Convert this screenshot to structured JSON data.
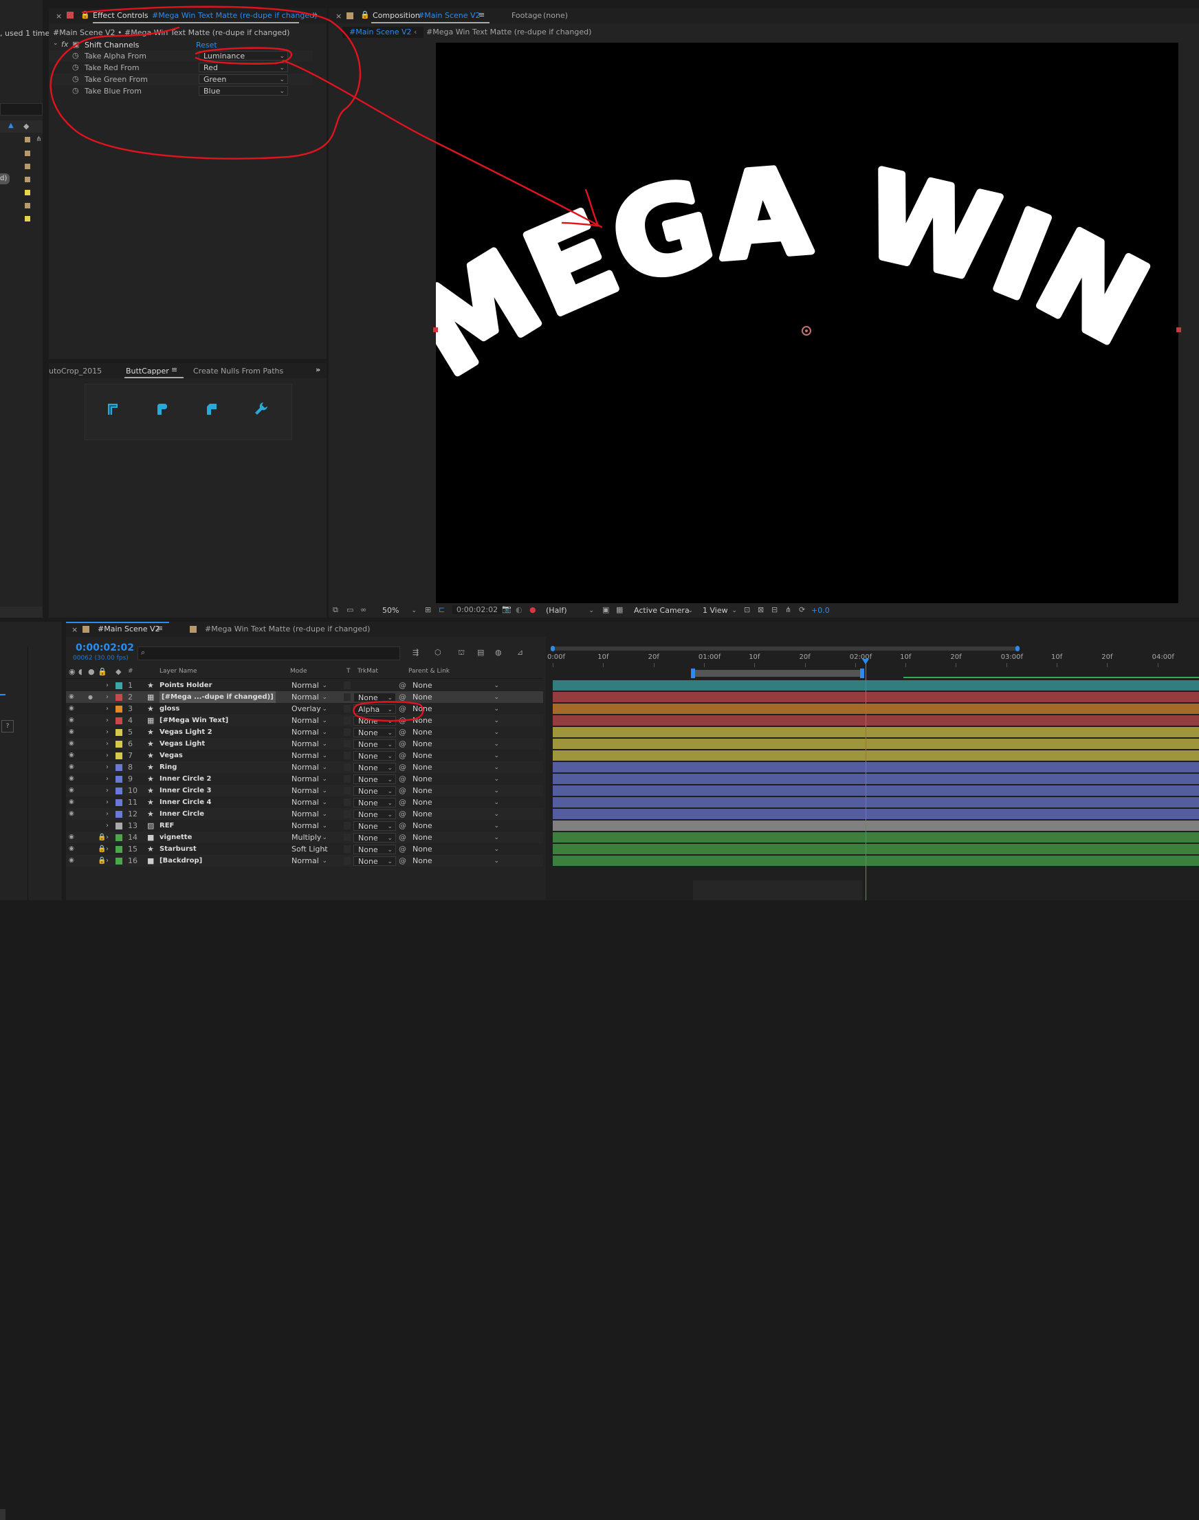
{
  "colors": {
    "accent": "#2d8ceb",
    "annotation": "#e0141e",
    "panel": "#232323",
    "teal": "#3aa6a6",
    "red": "#c8484b",
    "orange": "#e08a2c",
    "yellow": "#d6c84a",
    "blue": "#6a78d6",
    "gray": "#a9a9a9",
    "green": "#4aa84a",
    "cyan_icon": "#2aa8d8"
  },
  "left_strip": {
    "used_text": ", used 1 time",
    "label_d": "d)"
  },
  "effect_controls": {
    "tab_title": "Effect Controls",
    "tab_target": "#Mega Win Text Matte (re-dupe if changed)",
    "breadcrumb": "#Main Scene V2 • #Mega Win Text Matte (re-dupe if changed)",
    "effect_name": "Shift Channels",
    "reset": "Reset",
    "props": [
      {
        "label": "Take Alpha From",
        "value": "Luminance"
      },
      {
        "label": "Take Red From",
        "value": "Red"
      },
      {
        "label": "Take Green From",
        "value": "Green"
      },
      {
        "label": "Take Blue From",
        "value": "Blue"
      }
    ]
  },
  "scripts_panel": {
    "tabs": [
      "utoCrop_2015",
      "ButtCapper",
      "Create Nulls From Paths"
    ],
    "icons": [
      "butt-cap-icon",
      "round-cap-icon",
      "square-cap-icon",
      "wrench-icon"
    ]
  },
  "composition": {
    "tab_label": "Composition",
    "tab_name": "#Main Scene V2",
    "footage": "Footage",
    "footage_val": "(none)",
    "crumb_active": "#Main Scene V2",
    "crumb_next": "#Mega Win Text Matte (re-dupe if changed)",
    "canvas_text": "MEGA WIN!",
    "zoom": "50%",
    "timecode": "0:00:02:02",
    "resolution": "(Half)",
    "camera": "Active Camera",
    "views": "1 View",
    "exposure": "+0.0"
  },
  "timeline": {
    "tabs": [
      "#Main Scene V2",
      "#Mega Win Text Matte (re-dupe if changed)"
    ],
    "timecode": "0:00:02:02",
    "frame_info": "00062 (30.00 fps)",
    "headers": {
      "num": "#",
      "layer_name": "Layer Name",
      "mode": "Mode",
      "t": "T",
      "trkmat": "TrkMat",
      "parent": "Parent & Link"
    },
    "ruler": [
      "0:00f",
      "10f",
      "20f",
      "01:00f",
      "10f",
      "20f",
      "02:00f",
      "10f",
      "20f",
      "03:00f",
      "10f",
      "20f",
      "04:00f"
    ],
    "playhead_fraction": 0.497,
    "layers": [
      {
        "num": "1",
        "name": "Points Holder",
        "mode": "Normal",
        "trk": "",
        "parent": "None",
        "color": "#3aa6a6",
        "icon": "star-icon",
        "vis": false,
        "lock": false
      },
      {
        "num": "2",
        "name": "[#Mega ...-dupe if changed)]",
        "mode": "Normal",
        "trk": "None",
        "parent": "None",
        "color": "#c8484b",
        "icon": "precomp-icon",
        "vis": true,
        "lock": false,
        "selected": true
      },
      {
        "num": "3",
        "name": "gloss",
        "mode": "Overlay",
        "trk": "Alpha",
        "parent": "None",
        "color": "#e08a2c",
        "icon": "star-icon",
        "vis": true,
        "lock": false
      },
      {
        "num": "4",
        "name": "[#Mega Win Text]",
        "mode": "Normal",
        "trk": "None",
        "parent": "None",
        "color": "#c8484b",
        "icon": "precomp-icon",
        "vis": true,
        "lock": false
      },
      {
        "num": "5",
        "name": "Vegas Light 2",
        "mode": "Normal",
        "trk": "None",
        "parent": "None",
        "color": "#d6c84a",
        "icon": "star-icon",
        "vis": true,
        "lock": false
      },
      {
        "num": "6",
        "name": "Vegas Light",
        "mode": "Normal",
        "trk": "None",
        "parent": "None",
        "color": "#d6c84a",
        "icon": "star-icon",
        "vis": true,
        "lock": false
      },
      {
        "num": "7",
        "name": "Vegas",
        "mode": "Normal",
        "trk": "None",
        "parent": "None",
        "color": "#d6c84a",
        "icon": "star-icon",
        "vis": true,
        "lock": false
      },
      {
        "num": "8",
        "name": "Ring",
        "mode": "Normal",
        "trk": "None",
        "parent": "None",
        "color": "#6a78d6",
        "icon": "star-icon",
        "vis": true,
        "lock": false
      },
      {
        "num": "9",
        "name": "Inner Circle 2",
        "mode": "Normal",
        "trk": "None",
        "parent": "None",
        "color": "#6a78d6",
        "icon": "star-icon",
        "vis": true,
        "lock": false
      },
      {
        "num": "10",
        "name": "Inner Circle 3",
        "mode": "Normal",
        "trk": "None",
        "parent": "None",
        "color": "#6a78d6",
        "icon": "star-icon",
        "vis": true,
        "lock": false
      },
      {
        "num": "11",
        "name": "Inner Circle 4",
        "mode": "Normal",
        "trk": "None",
        "parent": "None",
        "color": "#6a78d6",
        "icon": "star-icon",
        "vis": true,
        "lock": false
      },
      {
        "num": "12",
        "name": "Inner Circle",
        "mode": "Normal",
        "trk": "None",
        "parent": "None",
        "color": "#6a78d6",
        "icon": "star-icon",
        "vis": true,
        "lock": false
      },
      {
        "num": "13",
        "name": "REF",
        "mode": "Normal",
        "trk": "None",
        "parent": "None",
        "color": "#a9a9a9",
        "icon": "footage-icon",
        "vis": false,
        "lock": false
      },
      {
        "num": "14",
        "name": "vignette",
        "mode": "Multiply",
        "trk": "None",
        "parent": "None",
        "color": "#4aa84a",
        "icon": "solid-icon",
        "vis": true,
        "lock": true
      },
      {
        "num": "15",
        "name": "Starburst",
        "mode": "Soft Light",
        "trk": "None",
        "parent": "None",
        "color": "#4aa84a",
        "icon": "star-icon",
        "vis": true,
        "lock": true
      },
      {
        "num": "16",
        "name": "[Backdrop]",
        "mode": "Normal",
        "trk": "None",
        "parent": "None",
        "color": "#4aa84a",
        "icon": "solid-icon",
        "vis": true,
        "lock": true
      }
    ]
  }
}
